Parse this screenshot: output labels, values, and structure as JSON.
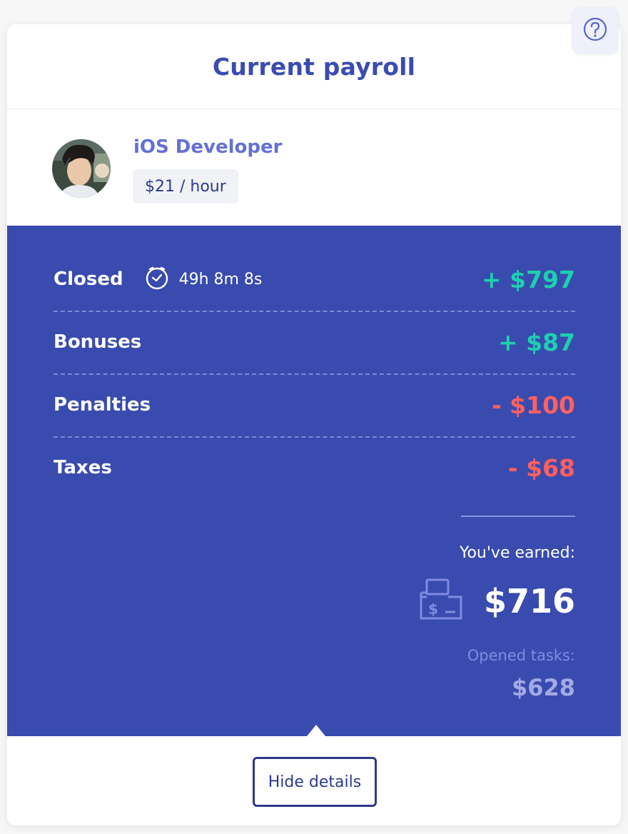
{
  "header": {
    "title": "Current payroll"
  },
  "help": {
    "icon": "question-icon"
  },
  "profile": {
    "role": "iOS Developer",
    "rate": "$21 / hour",
    "avatar_icon": "user-avatar"
  },
  "rows": [
    {
      "label": "Closed",
      "duration": "49h 8m 8s",
      "duration_icon": "clock-icon",
      "amount": "+ $797",
      "kind": "positive"
    },
    {
      "label": "Bonuses",
      "amount": "+ $87",
      "kind": "positive"
    },
    {
      "label": "Penalties",
      "amount": "- $100",
      "kind": "negative"
    },
    {
      "label": "Taxes",
      "amount": "- $68",
      "kind": "negative"
    }
  ],
  "summary": {
    "earned_label": "You've earned:",
    "earned_amount": "$716",
    "earned_icon": "cash-register-icon",
    "opened_label": "Opened tasks:",
    "opened_amount": "$628"
  },
  "actions": {
    "hide_details": "Hide details"
  },
  "colors": {
    "primary": "#394bae",
    "title": "#3b4cb0",
    "role": "#6470d6",
    "positive": "#1ecfb0",
    "negative": "#ff6060"
  }
}
